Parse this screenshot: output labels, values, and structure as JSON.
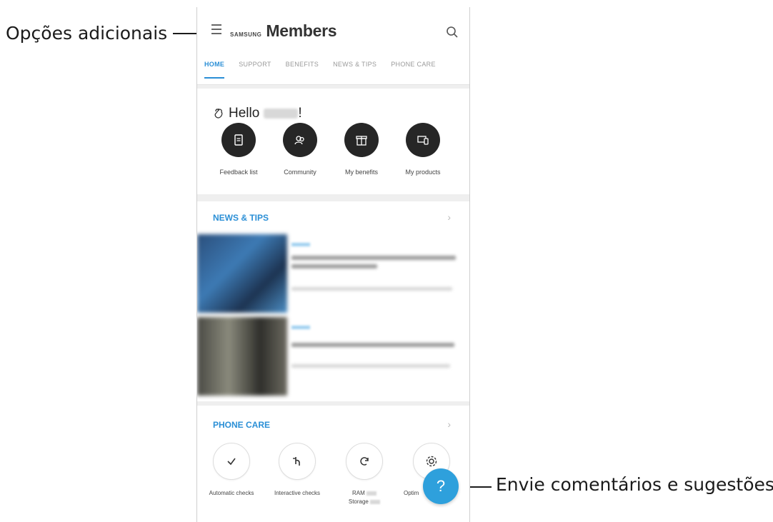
{
  "callouts": {
    "more_options": "Opções adicionais",
    "feedback": "Envie comentários e sugestões"
  },
  "app": {
    "brand_small": "SAMSUNG",
    "brand_big": "Members",
    "menu_icon": "hamburger-menu-icon",
    "search_icon": "search-icon"
  },
  "tabs": [
    {
      "label": "HOME",
      "active": true
    },
    {
      "label": "SUPPORT",
      "active": false
    },
    {
      "label": "BENEFITS",
      "active": false
    },
    {
      "label": "NEWS & TIPS",
      "active": false
    },
    {
      "label": "PHONE CARE",
      "active": false
    }
  ],
  "greeting": {
    "icon": "waving-hand-icon",
    "hello": "Hello",
    "suffix": "!"
  },
  "quick_actions": [
    {
      "label": "Feedback list",
      "icon": "document-icon"
    },
    {
      "label": "Community",
      "icon": "community-icon"
    },
    {
      "label": "My benefits",
      "icon": "gift-icon"
    },
    {
      "label": "My products",
      "icon": "devices-icon"
    }
  ],
  "news": {
    "title": "NEWS & TIPS",
    "chevron": "›"
  },
  "phone_care": {
    "title": "PHONE CARE",
    "chevron": "›",
    "items": [
      {
        "label": "Automatic checks",
        "icon": "check-icon"
      },
      {
        "label": "Interactive checks",
        "icon": "touch-icon"
      },
      {
        "label": "RAM",
        "label2": "Storage",
        "icon": "refresh-icon"
      },
      {
        "label": "Optim",
        "icon": "settings-icon"
      }
    ]
  },
  "fab": {
    "label": "?"
  },
  "colors": {
    "accent": "#2b8fd6",
    "fab": "#2ea0dc",
    "dark_circle": "#262626"
  }
}
